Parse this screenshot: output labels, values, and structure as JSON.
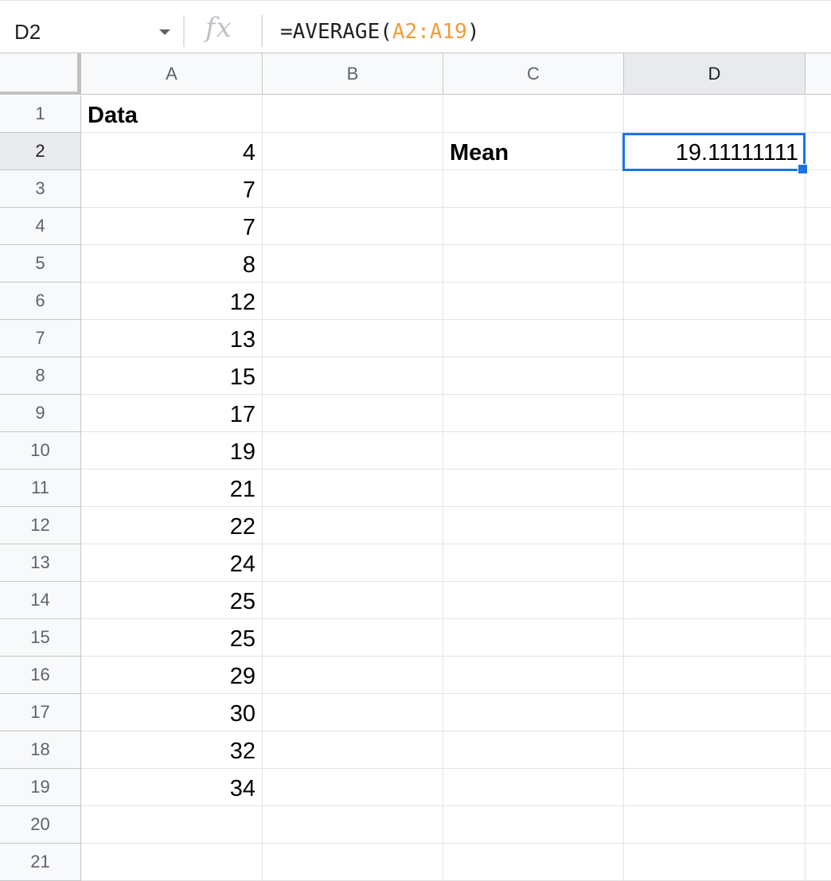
{
  "formula_bar": {
    "name_box": "D2",
    "fx_icon": "fx",
    "formula_prefix": "=AVERAGE(",
    "formula_range": "A2:A19",
    "formula_suffix": ")"
  },
  "columns": [
    "A",
    "B",
    "C",
    "D"
  ],
  "active_column": "D",
  "active_row": 2,
  "rows": [
    "1",
    "2",
    "3",
    "4",
    "5",
    "6",
    "7",
    "8",
    "9",
    "10",
    "11",
    "12",
    "13",
    "14",
    "15",
    "16",
    "17",
    "18",
    "19",
    "20",
    "21"
  ],
  "cells": {
    "A1": "Data",
    "A": [
      "4",
      "7",
      "7",
      "8",
      "12",
      "13",
      "15",
      "17",
      "19",
      "21",
      "22",
      "24",
      "25",
      "25",
      "29",
      "30",
      "32",
      "34"
    ],
    "C2": "Mean",
    "D2": "19.11111111"
  },
  "colors": {
    "selection": "#1a73e8",
    "range_highlight": "#f09c3c"
  }
}
